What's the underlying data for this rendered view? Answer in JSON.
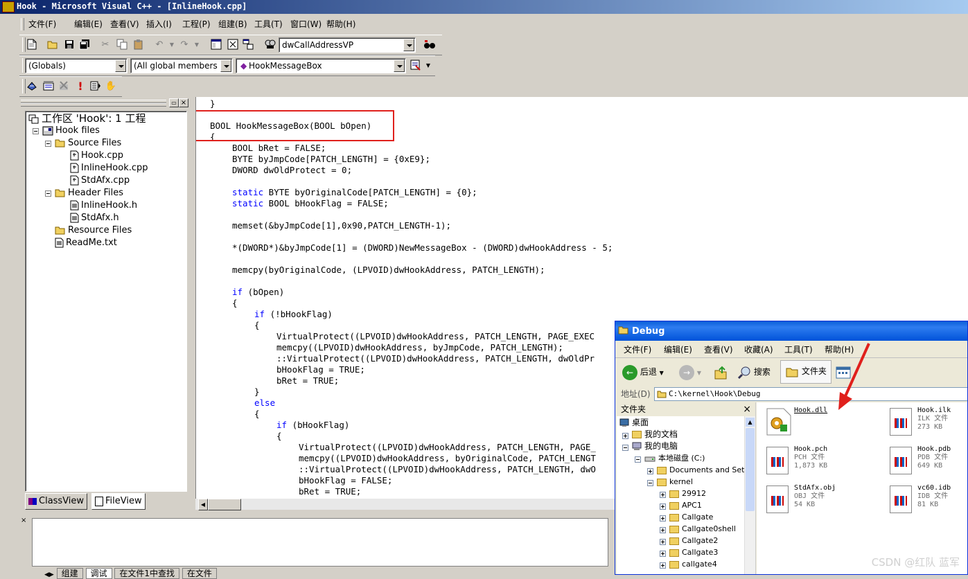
{
  "window": {
    "title": "Hook - Microsoft Visual C++ - [InlineHook.cpp]"
  },
  "menu": [
    "文件(F)",
    "编辑(E)",
    "查看(V)",
    "插入(I)",
    "工程(P)",
    "组建(B)",
    "工具(T)",
    "窗口(W)",
    "帮助(H)"
  ],
  "toolbar": {
    "find_combo": "dwCallAddressVP"
  },
  "wizardbar": {
    "class_combo": "(Globals)",
    "filter_combo": "(All global members",
    "member_combo": "HookMessageBox"
  },
  "workspace": {
    "tree": [
      {
        "label": "工作区 'Hook': 1 工程",
        "level": 0,
        "type": "workspace"
      },
      {
        "label": "Hook files",
        "level": 1,
        "type": "project"
      },
      {
        "label": "Source Files",
        "level": 2,
        "type": "folder"
      },
      {
        "label": "Hook.cpp",
        "level": 3,
        "type": "file"
      },
      {
        "label": "InlineHook.cpp",
        "level": 3,
        "type": "file"
      },
      {
        "label": "StdAfx.cpp",
        "level": 3,
        "type": "file"
      },
      {
        "label": "Header Files",
        "level": 2,
        "type": "folder"
      },
      {
        "label": "InlineHook.h",
        "level": 3,
        "type": "file"
      },
      {
        "label": "StdAfx.h",
        "level": 3,
        "type": "file"
      },
      {
        "label": "Resource Files",
        "level": 2,
        "type": "folder"
      },
      {
        "label": "ReadMe.txt",
        "level": 2,
        "type": "file"
      }
    ],
    "tabs": [
      "ClassView",
      "FileView"
    ]
  },
  "editor": {
    "lines": [
      {
        "indent": 0,
        "kw": "",
        "text": "}"
      },
      {
        "indent": 0,
        "kw": "",
        "text": ""
      },
      {
        "indent": 0,
        "kw": "",
        "text": "BOOL HookMessageBox(BOOL bOpen)"
      },
      {
        "indent": 0,
        "kw": "",
        "text": "{"
      },
      {
        "indent": 1,
        "kw": "",
        "text": "BOOL bRet = FALSE;"
      },
      {
        "indent": 1,
        "kw": "",
        "text": "BYTE byJmpCode[PATCH_LENGTH] = {0xE9};"
      },
      {
        "indent": 1,
        "kw": "",
        "text": "DWORD dwOldProtect = 0;"
      },
      {
        "indent": 1,
        "kw": "",
        "text": ""
      },
      {
        "indent": 1,
        "kw": "static",
        "text": " BYTE byOriginalCode[PATCH_LENGTH] = {0};"
      },
      {
        "indent": 1,
        "kw": "static",
        "text": " BOOL bHookFlag = FALSE;"
      },
      {
        "indent": 1,
        "kw": "",
        "text": ""
      },
      {
        "indent": 1,
        "kw": "",
        "text": "memset(&byJmpCode[1],0x90,PATCH_LENGTH-1);"
      },
      {
        "indent": 1,
        "kw": "",
        "text": ""
      },
      {
        "indent": 1,
        "kw": "",
        "text": "*(DWORD*)&byJmpCode[1] = (DWORD)NewMessageBox - (DWORD)dwHookAddress - 5;"
      },
      {
        "indent": 1,
        "kw": "",
        "text": ""
      },
      {
        "indent": 1,
        "kw": "",
        "text": "memcpy(byOriginalCode, (LPVOID)dwHookAddress, PATCH_LENGTH);"
      },
      {
        "indent": 1,
        "kw": "",
        "text": ""
      },
      {
        "indent": 1,
        "kw": "if",
        "text": " (bOpen)"
      },
      {
        "indent": 1,
        "kw": "",
        "text": "{"
      },
      {
        "indent": 2,
        "kw": "if",
        "text": " (!bHookFlag)"
      },
      {
        "indent": 2,
        "kw": "",
        "text": "{"
      },
      {
        "indent": 3,
        "kw": "",
        "text": "VirtualProtect((LPVOID)dwHookAddress, PATCH_LENGTH, PAGE_EXEC"
      },
      {
        "indent": 3,
        "kw": "",
        "text": "memcpy((LPVOID)dwHookAddress, byJmpCode, PATCH_LENGTH);"
      },
      {
        "indent": 3,
        "kw": "",
        "text": "::VirtualProtect((LPVOID)dwHookAddress, PATCH_LENGTH, dwOldPr"
      },
      {
        "indent": 3,
        "kw": "",
        "text": "bHookFlag = TRUE;"
      },
      {
        "indent": 3,
        "kw": "",
        "text": "bRet = TRUE;"
      },
      {
        "indent": 2,
        "kw": "",
        "text": "}"
      },
      {
        "indent": 2,
        "kw": "else",
        "text": ""
      },
      {
        "indent": 2,
        "kw": "",
        "text": "{"
      },
      {
        "indent": 3,
        "kw": "if",
        "text": " (bHookFlag)"
      },
      {
        "indent": 3,
        "kw": "",
        "text": "{"
      },
      {
        "indent": 4,
        "kw": "",
        "text": "VirtualProtect((LPVOID)dwHookAddress, PATCH_LENGTH, PAGE_"
      },
      {
        "indent": 4,
        "kw": "",
        "text": "memcpy((LPVOID)dwHookAddress, byOriginalCode, PATCH_LENGT"
      },
      {
        "indent": 4,
        "kw": "",
        "text": "::VirtualProtect((LPVOID)dwHookAddress, PATCH_LENGTH, dwO"
      },
      {
        "indent": 4,
        "kw": "",
        "text": "bHookFlag = FALSE;"
      },
      {
        "indent": 4,
        "kw": "",
        "text": "bRet = TRUE;"
      }
    ]
  },
  "output_tabs": [
    "组建",
    "调试",
    "在文件1中查找",
    "在文件"
  ],
  "explorer": {
    "title": "Debug",
    "menu": [
      "文件(F)",
      "编辑(E)",
      "查看(V)",
      "收藏(A)",
      "工具(T)",
      "帮助(H)"
    ],
    "toolbar": {
      "back": "后退",
      "search": "搜索",
      "folders": "文件夹"
    },
    "address_label": "地址(D)",
    "address": "C:\\kernel\\Hook\\Debug",
    "folders_header": "文件夹",
    "folder_tree": [
      {
        "label": "桌面",
        "level": 0
      },
      {
        "label": "我的文档",
        "level": 1
      },
      {
        "label": "我的电脑",
        "level": 1
      },
      {
        "label": "本地磁盘 (C:)",
        "level": 2
      },
      {
        "label": "Documents and Set",
        "level": 3
      },
      {
        "label": "kernel",
        "level": 3
      },
      {
        "label": "29912",
        "level": 4
      },
      {
        "label": "APC1",
        "level": 4
      },
      {
        "label": "Callgate",
        "level": 4
      },
      {
        "label": "Callgate0shell",
        "level": 4
      },
      {
        "label": "Callgate2",
        "level": 4
      },
      {
        "label": "Callgate3",
        "level": 4
      },
      {
        "label": "callgate4",
        "level": 4
      }
    ],
    "files": [
      {
        "name": "Hook.dll",
        "type": "",
        "size": ""
      },
      {
        "name": "Hook.ilk",
        "type": "ILK 文件",
        "size": "273 KB"
      },
      {
        "name": "Hook.pch",
        "type": "PCH 文件",
        "size": "1,873 KB"
      },
      {
        "name": "Hook.pdb",
        "type": "PDB 文件",
        "size": "649 KB"
      },
      {
        "name": "StdAfx.obj",
        "type": "OBJ 文件",
        "size": "54 KB"
      },
      {
        "name": "vc60.idb",
        "type": "IDB 文件",
        "size": "81 KB"
      }
    ]
  },
  "watermark": "CSDN @红队 蓝军",
  "colors": {
    "keyword": "#0000ff",
    "highlight_box": "#e0201c",
    "arrow": "#e0201c",
    "titlebar": "#0a246a"
  }
}
